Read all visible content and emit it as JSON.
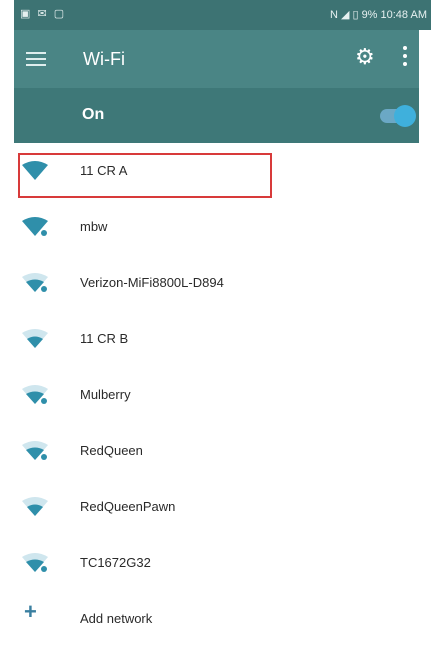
{
  "status_bar": {
    "left_icons": "▣ ✉ ▢",
    "right_text": "N  ◢ ▯ 9% 10:48 AM"
  },
  "app_bar": {
    "title": "Wi-Fi"
  },
  "toggle": {
    "label": "On",
    "state": "on"
  },
  "networks": [
    {
      "name": "11 CR A",
      "icon": "wifi-strong-icon",
      "selected": true
    },
    {
      "name": "mbw",
      "icon": "wifi-strong-icon"
    },
    {
      "name": "Verizon-MiFi8800L-D894",
      "icon": "wifi-locked-icon"
    },
    {
      "name": "11 CR B",
      "icon": "wifi-medium-icon"
    },
    {
      "name": "Mulberry",
      "icon": "wifi-locked-icon"
    },
    {
      "name": "RedQueen",
      "icon": "wifi-locked-icon"
    },
    {
      "name": "RedQueenPawn",
      "icon": "wifi-medium-icon"
    },
    {
      "name": "TC1672G32",
      "icon": "wifi-locked-icon"
    }
  ],
  "add_network": {
    "label": "Add network",
    "icon": "plus-icon"
  },
  "colors": {
    "appbar": "#4a8585",
    "accent": "#2f8faa",
    "highlight_border": "#d83a3a"
  }
}
